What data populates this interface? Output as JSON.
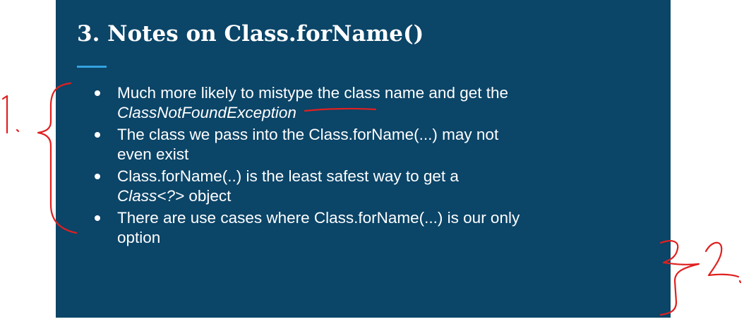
{
  "slide": {
    "background_color": "#0b4568",
    "accent_color": "#34a3e0",
    "title": "3. Notes on Class.forName()",
    "bullets": [
      {
        "parts": [
          "Much more likely to ",
          "mistype",
          " the class name and get the"
        ],
        "line2": "ClassNotFoundException",
        "line2_style": "italic"
      },
      {
        "line1": "The class we pass into the Class.forName(...) may not",
        "line2": "even exist"
      },
      {
        "line1": "Class.forName(..) is the least safest way to get a",
        "line2_italic": "Class<?>",
        "line2_rest": " object"
      },
      {
        "line1": "There are use cases where Class.forName(...) is our only",
        "line2": "option"
      }
    ]
  },
  "annotations": {
    "ink_color": "#e02020",
    "marks": [
      "left-brace",
      "number-1",
      "underline-mistype",
      "right-brace",
      "number-2"
    ]
  }
}
